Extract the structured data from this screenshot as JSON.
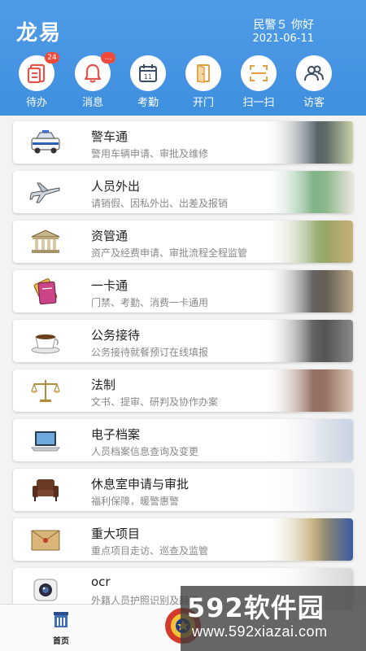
{
  "header": {
    "app_title": "龙易",
    "greeting": "民警５ 你好",
    "date": "2021-06-11",
    "bg_color": "#4a96e4"
  },
  "quick_actions": [
    {
      "label": "待办",
      "icon": "todo-icon",
      "badge": "24"
    },
    {
      "label": "消息",
      "icon": "bell-icon",
      "badge": "…"
    },
    {
      "label": "考勤",
      "icon": "calendar-icon",
      "day": "11"
    },
    {
      "label": "开门",
      "icon": "door-icon"
    },
    {
      "label": "扫一扫",
      "icon": "scan-icon"
    },
    {
      "label": "访客",
      "icon": "visitors-icon"
    }
  ],
  "services": [
    {
      "title": "警车通",
      "subtitle": "警用车辆申请、审批及维修",
      "icon": "police-car-icon"
    },
    {
      "title": "人员外出",
      "subtitle": "请销假、因私外出、出差及报销",
      "icon": "airplane-icon"
    },
    {
      "title": "资管通",
      "subtitle": "资产及经费申请、审批流程全程监管",
      "icon": "bank-icon"
    },
    {
      "title": "一卡通",
      "subtitle": "门禁、考勤、消费一卡通用",
      "icon": "card-icon"
    },
    {
      "title": "公务接待",
      "subtitle": "公务接待就餐预订在线填报",
      "icon": "coffee-cup-icon"
    },
    {
      "title": "法制",
      "subtitle": "文书、提审、研判及协作办案",
      "icon": "scales-icon"
    },
    {
      "title": "电子档案",
      "subtitle": "人员档案信息查询及变更",
      "icon": "laptop-icon"
    },
    {
      "title": "休息室申请与审批",
      "subtitle": "福利保障，暖警惠警",
      "icon": "armchair-icon"
    },
    {
      "title": "重大项目",
      "subtitle": "重点项目走访、巡查及监管",
      "icon": "envelope-icon"
    },
    {
      "title": "ocr",
      "subtitle": "外籍人员护照识别及翻译",
      "icon": "camera-icon"
    }
  ],
  "tabbar": {
    "home_label": "首页"
  },
  "watermark": {
    "brand": "592软件园",
    "url": "www.592xiazai.com"
  }
}
